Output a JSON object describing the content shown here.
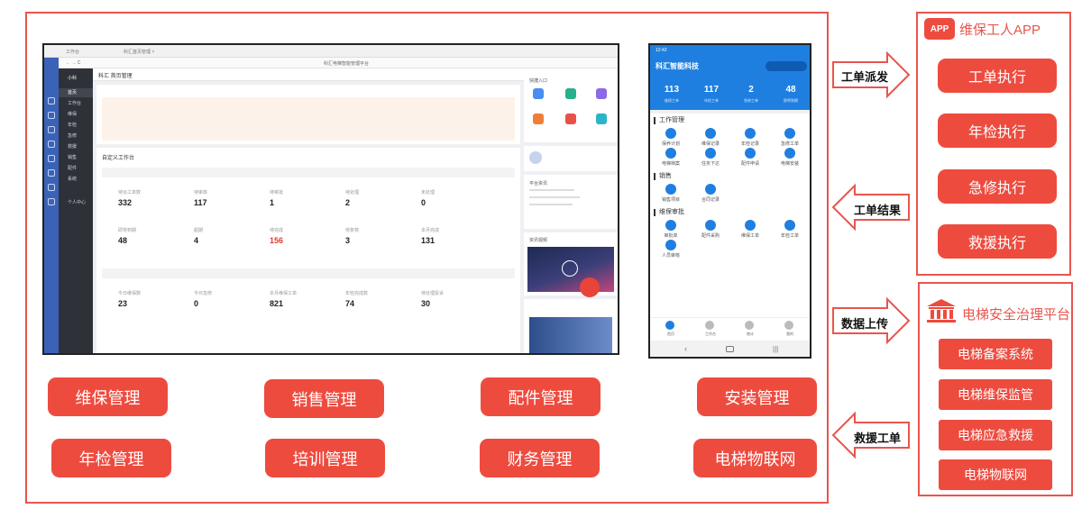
{
  "colors": {
    "accent": "#ee4b3f",
    "border": "#e8554e",
    "phone_blue": "#1f7fe0",
    "rail_blue": "#3a63b8"
  },
  "desktop": {
    "header_title": "科汇 首页管理",
    "side_title": "小科",
    "side_items": [
      "首页",
      "工作台",
      "维保",
      "年检",
      "急修",
      "救援",
      "销售",
      "配件",
      "系统",
      "个人中心"
    ],
    "workbench_title": "自定义工作台",
    "stats_group_1": [
      {
        "label": "待派工单数",
        "value": "332",
        "hl": false
      },
      {
        "label": "待审核",
        "value": "117",
        "hl": false
      },
      {
        "label": "待审批",
        "value": "1",
        "hl": false
      },
      {
        "label": "待处理",
        "value": "2",
        "hl": false
      },
      {
        "label": "未处理",
        "value": "0",
        "hl": false
      },
      {
        "label": "即将到期",
        "value": "48",
        "hl": false
      },
      {
        "label": "超期",
        "value": "4",
        "hl": false
      },
      {
        "label": "待完成",
        "value": "156",
        "hl": true
      },
      {
        "label": "待复核",
        "value": "3",
        "hl": false
      },
      {
        "label": "本月完成",
        "value": "131",
        "hl": false
      }
    ],
    "stats_group_2": [
      {
        "label": "今日维保数",
        "value": "23"
      },
      {
        "label": "今日急修",
        "value": "0"
      },
      {
        "label": "本月维保工单",
        "value": "821"
      },
      {
        "label": "年检完成数",
        "value": "74"
      },
      {
        "label": "待处理投诉",
        "value": "30"
      }
    ],
    "quick_title": "快捷入口",
    "news_title": "平台资讯",
    "video_title": "资讯视频"
  },
  "phone": {
    "status": "12:42",
    "title": "科汇智能科技",
    "stats": [
      {
        "value": "113",
        "label": "维保工单"
      },
      {
        "value": "117",
        "label": "年检工单"
      },
      {
        "value": "2",
        "label": "急修工单"
      },
      {
        "value": "48",
        "label": "即将到期"
      }
    ],
    "sections": [
      {
        "title": "工作管理",
        "items": [
          "保养计划",
          "维保记录",
          "年检记录",
          "急修工单",
          "电梯档案",
          "任务下达",
          "配件申请",
          "电梯安装"
        ]
      },
      {
        "title": "销售",
        "items": [
          "销售项目",
          "合同记录"
        ]
      },
      {
        "title": "维保审批",
        "items": [
          "审批单",
          "配件采购",
          "维保工单",
          "年检工单",
          "人员审核"
        ]
      }
    ],
    "tabs": [
      "首页",
      "工作台",
      "统计",
      "我的"
    ]
  },
  "modules_row1": [
    "维保管理",
    "销售管理",
    "配件管理",
    "安装管理"
  ],
  "modules_row2": [
    "年检管理",
    "培训管理",
    "财务管理",
    "电梯物联网"
  ],
  "arrows": [
    "工单派发",
    "工单结果",
    "数据上传",
    "救援工单"
  ],
  "app_panel": {
    "title": "维保工人APP",
    "logo_text": "APP",
    "buttons": [
      "工单执行",
      "年检执行",
      "急修执行",
      "救援执行"
    ]
  },
  "platform_panel": {
    "title": "电梯安全治理平台",
    "buttons": [
      "电梯备案系统",
      "电梯维保监管",
      "电梯应急救援",
      "电梯物联网"
    ]
  }
}
